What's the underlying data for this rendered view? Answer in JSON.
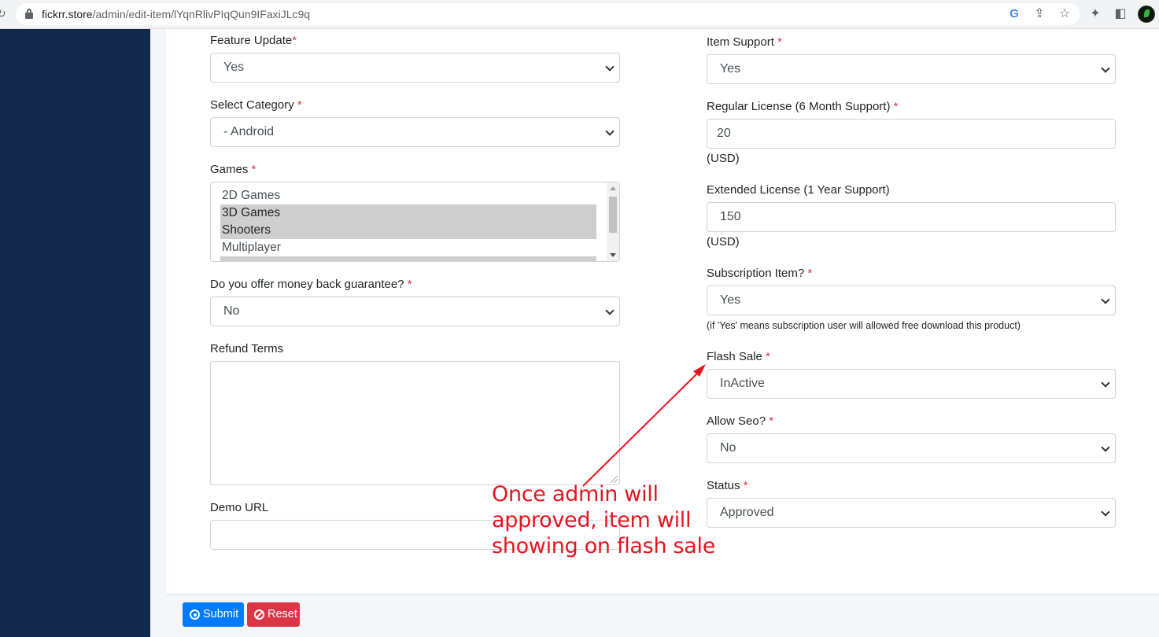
{
  "browser": {
    "url_host": "fickrr.store",
    "url_path": "/admin/edit-item/lYqnRlivPIqQun9IFaxiJLc9q"
  },
  "left_column": {
    "feature_update": {
      "label": "Feature Update",
      "required": "*",
      "value": "Yes"
    },
    "select_category": {
      "label": "Select Category",
      "required": "*",
      "value": "- Android"
    },
    "games": {
      "label": "Games",
      "required": "*",
      "options": [
        {
          "label": "2D Games",
          "selected": false
        },
        {
          "label": "3D Games",
          "selected": true
        },
        {
          "label": "Shooters",
          "selected": true
        },
        {
          "label": "Multiplayer",
          "selected": false
        }
      ]
    },
    "money_back": {
      "label": "Do you offer money back guarantee?",
      "required": "*",
      "value": "No"
    },
    "refund_terms": {
      "label": "Refund Terms",
      "value": ""
    },
    "demo_url": {
      "label": "Demo URL",
      "value": ""
    }
  },
  "right_column": {
    "item_support": {
      "label": "Item Support",
      "required": "*",
      "value": "Yes"
    },
    "regular_license": {
      "label": "Regular License (6 Month Support)",
      "required": "*",
      "value": "20",
      "unit": "(USD)"
    },
    "extended_license": {
      "label": "Extended License (1 Year Support)",
      "value": "150",
      "unit": "(USD)"
    },
    "subscription_item": {
      "label": "Subscription Item?",
      "required": "*",
      "value": "Yes",
      "help": "(if 'Yes' means subscription user will allowed free download this product)"
    },
    "flash_sale": {
      "label": "Flash Sale",
      "required": "*",
      "value": "InActive"
    },
    "allow_seo": {
      "label": "Allow Seo?",
      "required": "*",
      "value": "No"
    },
    "status": {
      "label": "Status",
      "required": "*",
      "value": "Approved"
    }
  },
  "annotation": {
    "lines": [
      "Once admin will",
      "approved, item will",
      "showing on flash sale"
    ],
    "color": "#e8141e"
  },
  "footer": {
    "submit_label": "Submit",
    "reset_label": "Reset"
  },
  "colors": {
    "sidebar": "#13294b",
    "submit": "#007bff",
    "reset": "#dc3545",
    "required": "#dc3545"
  }
}
